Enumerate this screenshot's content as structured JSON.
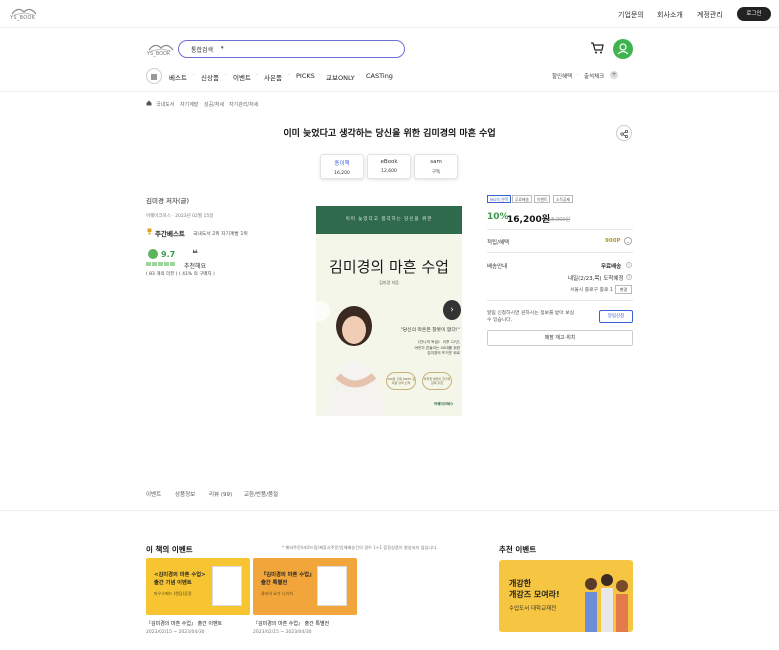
{
  "topbar": {
    "logo_text": "YS_BOOK",
    "links": [
      "기업문의",
      "회사소개",
      "계정관리"
    ],
    "login": "로그인"
  },
  "header": {
    "logo_text": "YS_BOOK",
    "search_category": "통합검색",
    "search_caret": "▾"
  },
  "nav": {
    "items": [
      "베스트",
      "신상품",
      "이벤트",
      "사은품",
      "PICKS",
      "교보ONLY",
      "CASTing"
    ],
    "right_label": "할인혜택",
    "right_label2": "출석체크",
    "plus": "+"
  },
  "breadcrumb": [
    "국내도서",
    "자기계발",
    "성공/처세",
    "자기관리/처세"
  ],
  "product": {
    "title": "이미 늦었다고 생각하는 당신을 위한 김미경의 마흔 수업",
    "formats": [
      {
        "name": "종이책",
        "price": "16,200",
        "active": true
      },
      {
        "name": "eBook",
        "price": "12,600",
        "active": false
      },
      {
        "name": "sam",
        "price": "구독",
        "active": false
      }
    ],
    "author": "김미경 저자(글)",
    "pubdate": "어웨이크북스 · 2023년 02월 15일",
    "weekly_label": "주간베스트",
    "weekly_category": "국내도서 2위 자기계발 1위",
    "rating": "9.7",
    "keyword_label": "추천해요",
    "reviews": "( 83 개의 리뷰 ) ( 41% 의 구매자 )",
    "tags": [
      "MD의 선택",
      "무료배송",
      "이벤트",
      "소득공제"
    ],
    "discount": "10%",
    "price": "16,200원",
    "original_price": "18,000원",
    "points_label": "적립/혜택",
    "points_value": "900P",
    "shipping_label": "배송안내",
    "shipping_free": "무료배송",
    "shipping_date": "내일(2/23,목) 도착예정",
    "shipping_address": "서울시 중로구 종로 1",
    "shipping_change": "변경",
    "notify_text": "알림 신청하시면 원하시는 정보를 받아 보실 수 있습니다.",
    "notify_button": "알림신청",
    "stock_button": "매장 재고·위치"
  },
  "cover": {
    "subtitle": "이미 늦었다고 생각하는 당신을 위한",
    "title": "김미경의 마흔 수업",
    "author": "김미경 지음",
    "quote": "\"당신의 마흔은 찰못이 없다!\"",
    "desc1": "《언니의 독설》 이후 12년,",
    "desc2": "여전히 흔들리는 40대를 위한",
    "desc3": "김미경의 뜨거운 위로",
    "badge1": "100만 구독 MKTV 김미경 강력 신작",
    "badge2": "이렇게 솔찬이 한가지 강력 추천",
    "publisher": "어웨이크북스"
  },
  "tabs": [
    "이벤트",
    "상품정보",
    "리뷰 (99)",
    "교환/반품/품절"
  ],
  "events": {
    "section_title": "이 책의 이벤트",
    "note": "* 해외주문/바로드림/제휴사주문/업체배송건의 경우 1+1 증정상품이 발송되지 않습니다.",
    "items": [
      {
        "line1": "<김미경의 마흔 수업>",
        "line2": "출간 기념 이벤트",
        "small": "마우스패드 (랜덤)증정",
        "title": "『김미경의 마흔 수업』 출간 이벤트",
        "date": "2023/02/15 ~ 2023/04/30"
      },
      {
        "line1": "『김미경의 마흔 수업』",
        "line2": "출간 특별전",
        "small": "클리어 요가 나이지",
        "title": "『김미경의 마흔 수업』 출간 특별전",
        "date": "2023/02/15 ~ 2023/04/30"
      }
    ],
    "recommend_title": "추천 이벤트",
    "recommend_line1": "개강한",
    "recommend_line2": "개강즈 모여라!",
    "recommend_line3": "수업도서 대학교재전"
  },
  "colors": {
    "accent_green": "#3a9a4a",
    "accent_blue": "#3c63d6",
    "banner_yellow": "#f7c531",
    "banner_orange": "#f2a53a"
  }
}
